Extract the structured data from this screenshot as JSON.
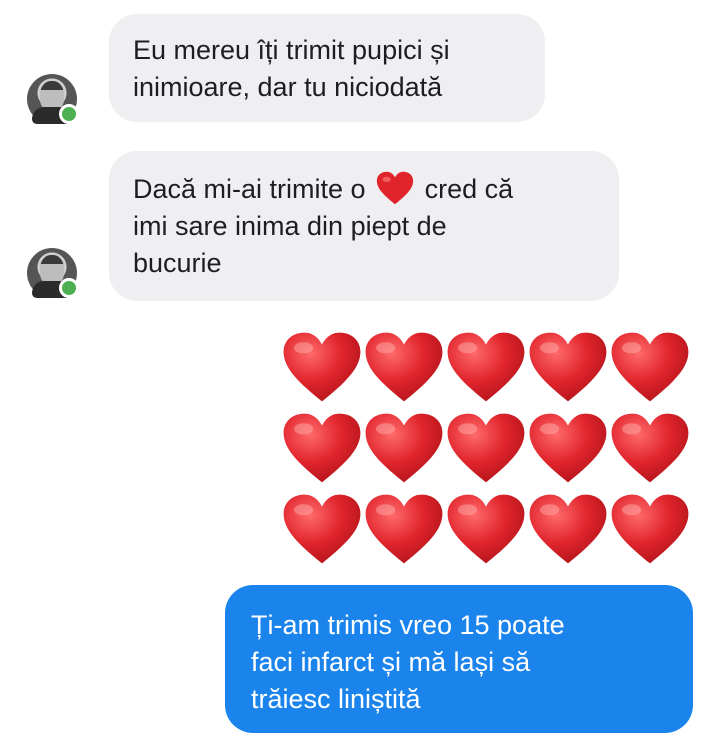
{
  "messages": [
    {
      "sender": "contact",
      "lines": [
        "Eu mereu îți trimit pupici și",
        "inimioare, dar tu niciodată"
      ]
    },
    {
      "sender": "contact",
      "line1_before": "Dacă mi-ai trimite o",
      "line1_after": "cred că",
      "lines_rest": [
        "imi sare inima din piept de",
        "bucurie"
      ]
    },
    {
      "sender": "me",
      "hearts_count": 15
    },
    {
      "sender": "me",
      "lines": [
        "Ți-am trimis vreo 15 poate",
        "faci infarct și mă lași să",
        "trăiesc liniștită"
      ]
    }
  ],
  "colors": {
    "incoming_bubble": "#efeff1",
    "outgoing_bubble": "#1b84ec",
    "heart": "#e0242c",
    "online": "#4caf50"
  },
  "icons": {
    "heart": "red-heart-emoji",
    "avatar": "contact-avatar"
  }
}
